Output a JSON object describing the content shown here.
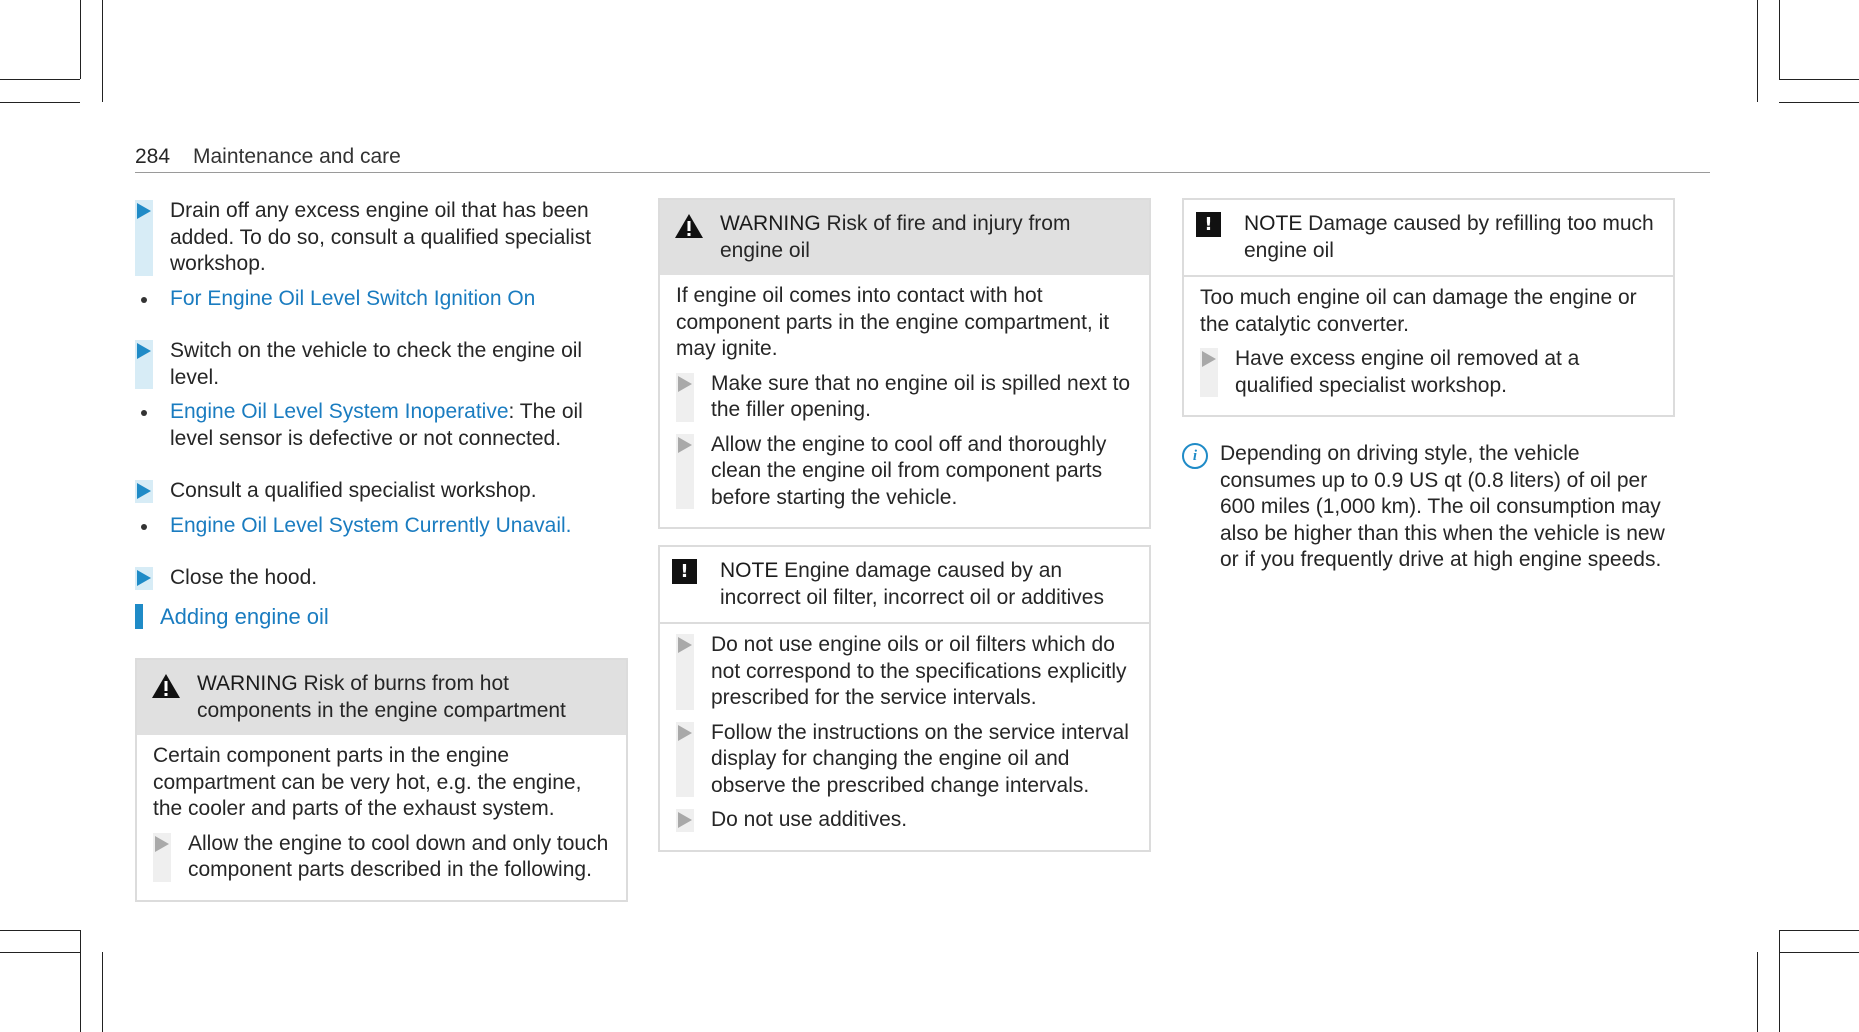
{
  "header": {
    "page_number": "284",
    "title": "Maintenance and care"
  },
  "col1": {
    "step1": "Drain off any excess engine oil that has been added. To do so, consult a qualified specialist workshop.",
    "bullet1_link": "For Engine Oil Level Switch Ignition On",
    "step2": "Switch on the vehicle to check the engine oil level.",
    "bullet2_link": "Engine Oil Level System Inoperative",
    "bullet2_text": ": The oil level sensor is defective or not connected.",
    "step3": "Consult a qualified specialist workshop.",
    "bullet3_link": "Engine Oil Level System Currently Unavail.",
    "step4": "Close the hood.",
    "section_title": "Adding engine oil",
    "warning1": {
      "keyword": "WARNING",
      "title": " Risk of burns from hot components in the engine compartment",
      "body": "Certain component parts in the engine compartment can be very hot, e.g. the engine, the cooler and parts of the exhaust system.",
      "step": "Allow the engine to cool down and only touch component parts described in the following."
    }
  },
  "col2": {
    "warning2": {
      "keyword": "WARNING",
      "title": " Risk of fire and injury from engine oil",
      "body": "If engine oil comes into contact with hot component parts in the engine compartment, it may ignite.",
      "step1": "Make sure that no engine oil is spilled next to the filler opening.",
      "step2": "Allow the engine to cool off and thoroughly clean the engine oil from component parts before starting the vehicle."
    },
    "note1": {
      "keyword": "NOTE",
      "title": " Engine damage caused by an incorrect oil filter, incorrect oil or additives",
      "step1": "Do not use engine oils or oil filters which do not correspond to the specifications explicitly prescribed for the service intervals.",
      "step2": "Follow the instructions on the service interval display for changing the engine oil and observe the prescribed change intervals.",
      "step3": "Do not use additives."
    }
  },
  "col3": {
    "note2": {
      "keyword": "NOTE",
      "title": " Damage caused by refilling too much engine oil",
      "body": "Too much engine oil can damage the engine or the catalytic converter.",
      "step": "Have excess engine oil removed at a qualified specialist workshop."
    },
    "info": "Depending on driving style, the vehicle consumes up to 0.9 US qt (0.8 liters) of oil per 600 miles (1,000 km). The oil consumption may also be higher than this when the vehicle is new or if you frequently drive at high engine speeds."
  },
  "icons": {
    "warning": "warning-triangle-icon",
    "note": "note-exclamation-icon",
    "info": "info-icon",
    "step": "step-arrow-icon"
  },
  "colors": {
    "accent": "#1a7cc0",
    "box_header": "#e0e0e0"
  }
}
